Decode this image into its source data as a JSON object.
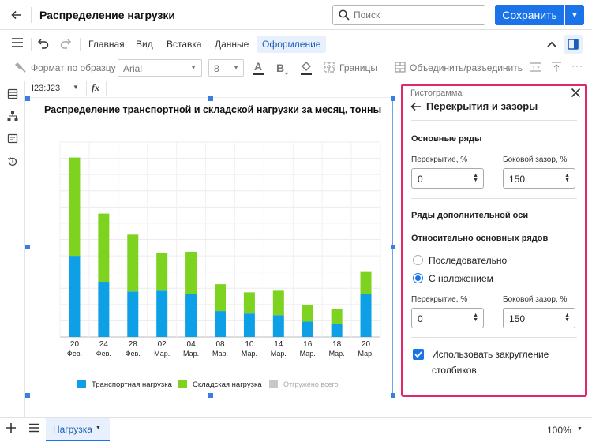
{
  "header": {
    "title": "Распределение нагрузки",
    "search_placeholder": "Поиск",
    "save_label": "Сохранить"
  },
  "menu": {
    "tabs": [
      {
        "label": "Главная"
      },
      {
        "label": "Вид"
      },
      {
        "label": "Вставка"
      },
      {
        "label": "Данные"
      },
      {
        "label": "Оформление"
      }
    ]
  },
  "format_toolbar": {
    "painter_label": "Формат по образцу",
    "font": "Arial",
    "font_size": "8",
    "borders_label": "Границы",
    "merge_label": "Объединить/разъединить"
  },
  "formula_bar": {
    "cell_ref": "I23:J23",
    "fx": "fx"
  },
  "chart_data": {
    "type": "bar",
    "stacked": true,
    "title": "Распределение транспортной и складской нагрузки за месяц, тонны",
    "categories": [
      "20 Фев.",
      "24 Фев.",
      "28 Фев.",
      "02 Мар.",
      "04 Мар.",
      "08 Мар.",
      "10 Мар.",
      "14 Мар.",
      "16 Мар.",
      "18 Мар.",
      "20 Мар."
    ],
    "category_days": [
      "20",
      "24",
      "28",
      "02",
      "04",
      "08",
      "10",
      "14",
      "16",
      "18",
      "20"
    ],
    "category_months": [
      "Фев.",
      "Фев.",
      "Фев.",
      "Мар.",
      "Мар.",
      "Мар.",
      "Мар.",
      "Мар.",
      "Мар.",
      "Мар.",
      "Мар."
    ],
    "series": [
      {
        "name": "Транспортная нагрузка",
        "color": "#0ea0e6",
        "values": [
          100,
          68,
          56,
          57,
          53,
          32,
          29,
          27,
          19,
          16,
          53
        ]
      },
      {
        "name": "Складская нагрузка",
        "color": "#7ed321",
        "values": [
          121,
          84,
          70,
          47,
          52,
          33,
          26,
          30,
          20,
          19,
          28
        ]
      }
    ],
    "legend_extra": "Отгружено всего",
    "legend_extra_color": "#c8c8c8",
    "ylim": [
      0,
      240
    ],
    "grid": true,
    "legend_position": "bottom"
  },
  "panel": {
    "chart_type": "Гистограмма",
    "section_title": "Перекрытия и зазоры",
    "main_series_title": "Основные ряды",
    "overlap_label": "Перекрытие, %",
    "gap_label": "Боковой зазор, %",
    "main_overlap": "0",
    "main_gap": "150",
    "secondary_title": "Ряды дополнительной оси",
    "relative_title": "Относительно основных рядов",
    "radio_sequential": "Последовательно",
    "radio_overlay": "С наложением",
    "secondary_overlap": "0",
    "secondary_gap": "150",
    "rounding_label_line1": "Использовать закругление",
    "rounding_label_line2": "столбиков"
  },
  "footer": {
    "sheet_name": "Нагрузка",
    "zoom": "100%"
  }
}
